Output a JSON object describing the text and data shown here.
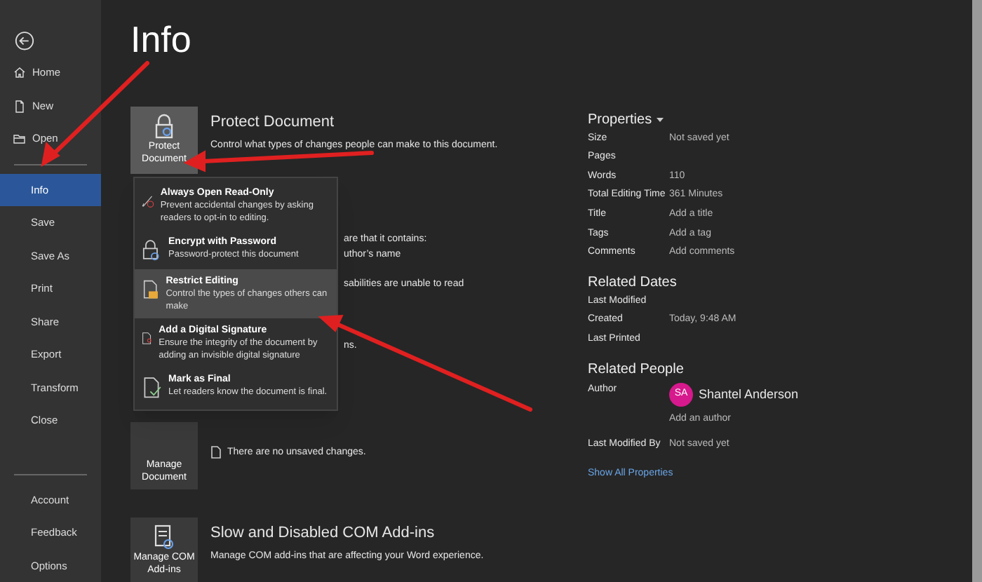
{
  "sidebar": {
    "top": [
      {
        "label": "Home",
        "selected": false
      },
      {
        "label": "New",
        "selected": false
      },
      {
        "label": "Open",
        "selected": false
      }
    ],
    "middle": [
      {
        "label": "Info",
        "selected": true
      },
      {
        "label": "Save",
        "selected": false
      },
      {
        "label": "Save As",
        "selected": false
      },
      {
        "label": "Print",
        "selected": false
      },
      {
        "label": "Share",
        "selected": false
      },
      {
        "label": "Export",
        "selected": false
      },
      {
        "label": "Transform",
        "selected": false
      },
      {
        "label": "Close",
        "selected": false
      }
    ],
    "bottom": [
      {
        "label": "Account",
        "selected": false
      },
      {
        "label": "Feedback",
        "selected": false
      },
      {
        "label": "Options",
        "selected": false
      }
    ]
  },
  "title": "Info",
  "protect": {
    "button": [
      "Protect",
      "Document"
    ],
    "heading": "Protect Document",
    "description": "Control what types of changes people can make to this document."
  },
  "inspect_fragments": [
    "are that it contains:",
    "uthor’s name",
    "sabilities are unable to read",
    "ns."
  ],
  "protect_menu": [
    {
      "title": "Always Open Read-Only",
      "description": "Prevent accidental changes by asking readers to opt-in to editing.",
      "selected": false
    },
    {
      "title": "Encrypt with Password",
      "description": "Password-protect this document",
      "selected": false
    },
    {
      "title": "Restrict Editing",
      "description": "Control the types of changes others can make",
      "selected": true
    },
    {
      "title": "Add a Digital Signature",
      "description": "Ensure the integrity of the document by adding an invisible digital signature",
      "selected": false
    },
    {
      "title": "Mark as Final",
      "description": "Let readers know the document is final.",
      "selected": false
    }
  ],
  "manage": {
    "button": [
      "Manage",
      "Document"
    ],
    "note": "There are no unsaved changes."
  },
  "com": {
    "button": [
      "Manage COM",
      "Add-ins"
    ],
    "heading": "Slow and Disabled COM Add-ins",
    "description": "Manage COM add-ins that are affecting your Word experience."
  },
  "properties": {
    "heading": "Properties",
    "rows": [
      {
        "label": "Size",
        "value": "Not saved yet"
      },
      {
        "label": "Pages"
      },
      {
        "label": "Words",
        "value": "110"
      },
      {
        "label": "Total Editing Time",
        "value": "361 Minutes"
      },
      {
        "label": "Title",
        "value": "Add a title"
      },
      {
        "label": "Tags",
        "value": "Add a tag"
      },
      {
        "label": "Comments",
        "value": "Add comments"
      }
    ]
  },
  "related_dates": {
    "heading": "Related Dates",
    "rows": [
      {
        "label": "Last Modified"
      },
      {
        "label": "Created",
        "value": "Today, 9:48 AM"
      },
      {
        "label": "Last Printed"
      }
    ]
  },
  "related_people": {
    "heading": "Related People",
    "author_label": "Author",
    "author": {
      "initials": "SA",
      "name": "Shantel Anderson",
      "color": "#d6198c"
    },
    "add_author": "Add an author",
    "last_modified_label": "Last Modified By",
    "last_modified_value": "Not saved yet",
    "show_all": "Show All Properties"
  }
}
